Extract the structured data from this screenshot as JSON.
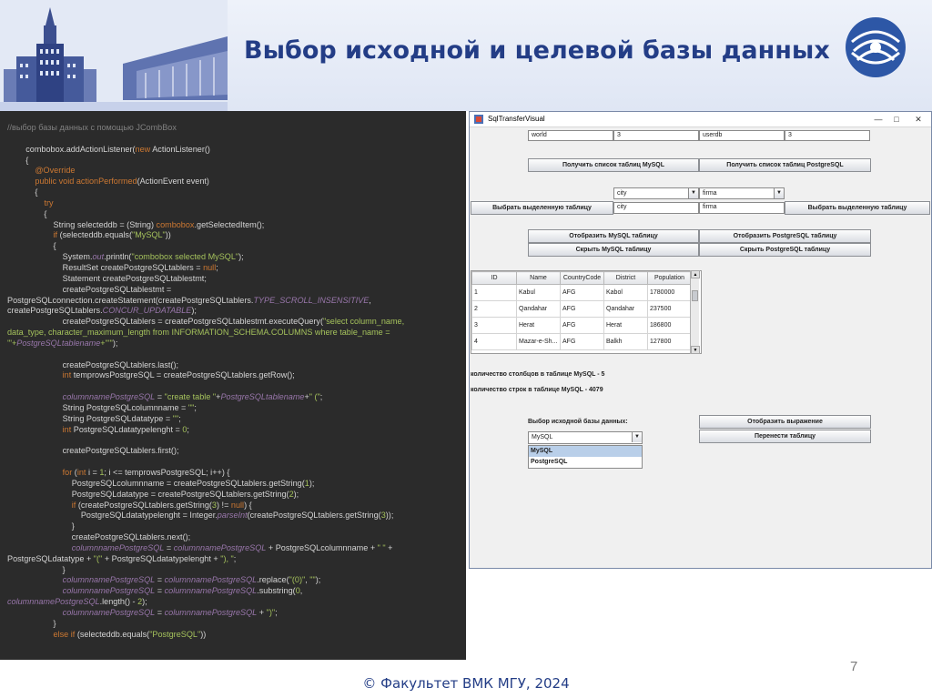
{
  "slide": {
    "title": "Выбор исходной и целевой базы данных",
    "page_number": "7",
    "footer": "© Факультет ВМК МГУ, 2024"
  },
  "code": {
    "lines": [
      [
        [
          "cm",
          "//выбор базы данных с помощью JCombBox"
        ]
      ],
      [
        [
          "",
          " "
        ]
      ],
      [
        [
          "",
          "        combobox.addActionListener("
        ],
        [
          "kw",
          "new"
        ],
        [
          "",
          " ActionListener()"
        ]
      ],
      [
        [
          "",
          "        {"
        ]
      ],
      [
        [
          "",
          "            "
        ],
        [
          "kw",
          "@Override"
        ]
      ],
      [
        [
          "",
          "            "
        ],
        [
          "kw",
          "public void"
        ],
        [
          "",
          " "
        ],
        [
          "kw",
          "actionPerformed"
        ],
        [
          "",
          "(ActionEvent event)"
        ]
      ],
      [
        [
          "",
          "            {"
        ]
      ],
      [
        [
          "",
          "                "
        ],
        [
          "kw",
          "try"
        ]
      ],
      [
        [
          "",
          "                {"
        ]
      ],
      [
        [
          "",
          "                    String selecteddb = (String) "
        ],
        [
          "kw",
          "combobox"
        ],
        [
          "",
          ".getSelectedItem();"
        ]
      ],
      [
        [
          "",
          "                    "
        ],
        [
          "kw",
          "if"
        ],
        [
          "",
          " (selecteddb.equals("
        ],
        [
          "st",
          "\"MySQL\""
        ],
        [
          "",
          "))"
        ]
      ],
      [
        [
          "",
          "                    {"
        ]
      ],
      [
        [
          "",
          "                        System."
        ],
        [
          "it",
          "out"
        ],
        [
          "",
          ".println("
        ],
        [
          "st",
          "\"combobox selected MySQL\""
        ],
        [
          "",
          ");"
        ]
      ],
      [
        [
          "",
          "                        ResultSet createPostgreSQLtablers = "
        ],
        [
          "kw",
          "null"
        ],
        [
          "",
          ";"
        ]
      ],
      [
        [
          "",
          "                        Statement createPostgreSQLtablestmt;"
        ]
      ],
      [
        [
          "",
          "                        createPostgreSQLtablestmt ="
        ]
      ],
      [
        [
          "",
          "PostgreSQLconnection.createStatement(createPostgreSQLtablers."
        ],
        [
          "it",
          "TYPE_SCROLL_INSENSITIVE"
        ],
        [
          "",
          ","
        ]
      ],
      [
        [
          "",
          "createPostgreSQLtablers."
        ],
        [
          "it",
          "CONCUR_UPDATABLE"
        ],
        [
          "",
          ");"
        ]
      ],
      [
        [
          "",
          "                        createPostgreSQLtablers = createPostgreSQLtablestmt.executeQuery("
        ],
        [
          "st",
          "\"select column_name,"
        ]
      ],
      [
        [
          "st",
          "data_type, character_maximum_length from INFORMATION_SCHEMA.COLUMNS where table_name ="
        ]
      ],
      [
        [
          "st",
          "'\"+"
        ],
        [
          "it",
          "PostgreSQLtablename"
        ],
        [
          "st",
          "+\"'\""
        ],
        [
          "",
          ");"
        ]
      ],
      [
        [
          "",
          " "
        ]
      ],
      [
        [
          "",
          "                        createPostgreSQLtablers.last();"
        ]
      ],
      [
        [
          "",
          "                        "
        ],
        [
          "kw",
          "int"
        ],
        [
          "",
          " temprowsPostgreSQL = createPostgreSQLtablers.getRow();"
        ]
      ],
      [
        [
          "",
          " "
        ]
      ],
      [
        [
          "",
          "                        "
        ],
        [
          "it",
          "columnnamePostgreSQL"
        ],
        [
          "",
          " = "
        ],
        [
          "st",
          "\"create table \""
        ],
        [
          "",
          "+"
        ],
        [
          "it",
          "PostgreSQLtablename"
        ],
        [
          "",
          "+"
        ],
        [
          "st",
          "\" (\""
        ],
        [
          "",
          ";"
        ]
      ],
      [
        [
          "",
          "                        String PostgreSQLcolumnname = "
        ],
        [
          "st",
          "\"\""
        ],
        [
          "",
          ";"
        ]
      ],
      [
        [
          "",
          "                        String PostgreSQLdatatype = "
        ],
        [
          "st",
          "\"\""
        ],
        [
          "",
          ";"
        ]
      ],
      [
        [
          "",
          "                        "
        ],
        [
          "kw",
          "int"
        ],
        [
          "",
          " PostgreSQLdatatypelenght = "
        ],
        [
          "st",
          "0"
        ],
        [
          "",
          ";"
        ]
      ],
      [
        [
          "",
          " "
        ]
      ],
      [
        [
          "",
          "                        createPostgreSQLtablers.first();"
        ]
      ],
      [
        [
          "",
          " "
        ]
      ],
      [
        [
          "",
          "                        "
        ],
        [
          "kw",
          "for"
        ],
        [
          "",
          " ("
        ],
        [
          "kw",
          "int"
        ],
        [
          "",
          " i = "
        ],
        [
          "st",
          "1"
        ],
        [
          "",
          "; i <= temprowsPostgreSQL; i++) {"
        ]
      ],
      [
        [
          "",
          "                            PostgreSQLcolumnname = createPostgreSQLtablers.getString("
        ],
        [
          "st",
          "1"
        ],
        [
          "",
          ");"
        ]
      ],
      [
        [
          "",
          "                            PostgreSQLdatatype = createPostgreSQLtablers.getString("
        ],
        [
          "st",
          "2"
        ],
        [
          "",
          ");"
        ]
      ],
      [
        [
          "",
          "                            "
        ],
        [
          "kw",
          "if"
        ],
        [
          "",
          " (createPostgreSQLtablers.getString("
        ],
        [
          "st",
          "3"
        ],
        [
          "",
          ") != "
        ],
        [
          "kw",
          "null"
        ],
        [
          "",
          ") {"
        ]
      ],
      [
        [
          "",
          "                                PostgreSQLdatatypelenght = Integer."
        ],
        [
          "it",
          "parseInt"
        ],
        [
          "",
          "(createPostgreSQLtablers.getString("
        ],
        [
          "st",
          "3"
        ],
        [
          "",
          "));"
        ]
      ],
      [
        [
          "",
          "                            }"
        ]
      ],
      [
        [
          "",
          "                            createPostgreSQLtablers.next();"
        ]
      ],
      [
        [
          "",
          "                            "
        ],
        [
          "it",
          "columnnamePostgreSQL"
        ],
        [
          "",
          " = "
        ],
        [
          "it",
          "columnnamePostgreSQL"
        ],
        [
          "",
          " + PostgreSQLcolumnname + "
        ],
        [
          "st",
          "\" \""
        ],
        [
          "",
          " +"
        ]
      ],
      [
        [
          "",
          "PostgreSQLdatatype + "
        ],
        [
          "st",
          "\"(\""
        ],
        [
          "",
          " + PostgreSQLdatatypelenght + "
        ],
        [
          "st",
          "\"), \""
        ],
        [
          "",
          ";"
        ]
      ],
      [
        [
          "",
          "                        }"
        ]
      ],
      [
        [
          "",
          "                        "
        ],
        [
          "it",
          "columnnamePostgreSQL"
        ],
        [
          "",
          " = "
        ],
        [
          "it",
          "columnnamePostgreSQL"
        ],
        [
          "",
          ".replace("
        ],
        [
          "st",
          "\"(0)\""
        ],
        [
          "",
          ", "
        ],
        [
          "st",
          "\"\""
        ],
        [
          "",
          ");"
        ]
      ],
      [
        [
          "",
          "                        "
        ],
        [
          "it",
          "columnnamePostgreSQL"
        ],
        [
          "",
          " = "
        ],
        [
          "it",
          "columnnamePostgreSQL"
        ],
        [
          "",
          ".substring("
        ],
        [
          "st",
          "0"
        ],
        [
          "",
          ","
        ]
      ],
      [
        [
          "it",
          "columnnamePostgreSQL"
        ],
        [
          "",
          ".length() - "
        ],
        [
          "st",
          "2"
        ],
        [
          "",
          ");"
        ]
      ],
      [
        [
          "",
          "                        "
        ],
        [
          "it",
          "columnnamePostgreSQL"
        ],
        [
          "",
          " = "
        ],
        [
          "it",
          "columnnamePostgreSQL"
        ],
        [
          "",
          " + "
        ],
        [
          "st",
          "\")\""
        ],
        [
          "",
          ";"
        ]
      ],
      [
        [
          "",
          "                    }"
        ]
      ],
      [
        [
          "",
          "                    "
        ],
        [
          "kw",
          "else if"
        ],
        [
          "",
          " (selecteddb.equals("
        ],
        [
          "st",
          "\"PostgreSQL\""
        ],
        [
          "",
          "))"
        ]
      ]
    ]
  },
  "window": {
    "title": "SqlTransferVisual",
    "fields_row": [
      "world",
      "3",
      "userdb",
      "3"
    ],
    "btn_get_mysql": "Получить список таблиц MySQL",
    "btn_get_pg": "Получить список таблиц PostgreSQL",
    "combo_mysql_table": "city",
    "combo_pg_table": "firma",
    "btn_select_left": "Выбрать выделенную таблицу",
    "btn_select_right": "Выбрать выделенную таблицу",
    "field_left_table": "city",
    "field_right_table": "firma",
    "btn_show_mysql": "Отобразить MySQL таблицу",
    "btn_show_pg": "Отобразить PostgreSQL таблицу",
    "btn_hide_mysql": "Скрыть MySQL таблицу",
    "btn_hide_pg": "Скрыть PostgreSQL таблицу",
    "table": {
      "headers": [
        "ID",
        "Name",
        "CountryCode",
        "District",
        "Population"
      ],
      "rows": [
        [
          "1",
          "Kabul",
          "AFG",
          "Kabol",
          "1780000"
        ],
        [
          "2",
          "Qandahar",
          "AFG",
          "Qandahar",
          "237500"
        ],
        [
          "3",
          "Herat",
          "AFG",
          "Herat",
          "186800"
        ],
        [
          "4",
          "Mazar-e-Sh...",
          "AFG",
          "Balkh",
          "127800"
        ]
      ]
    },
    "info_columns": "количество столбцов в таблице MySQL - 5",
    "info_rows": "количество строк в таблице MySQL - 4079",
    "source_db_label": "Выбор исходной базы данных:",
    "source_db_value": "MySQL",
    "source_db_options": [
      "MySQL",
      "PostgreSQL"
    ],
    "btn_show_expression": "Отобразить выражение",
    "btn_transfer": "Перенести таблицу"
  }
}
